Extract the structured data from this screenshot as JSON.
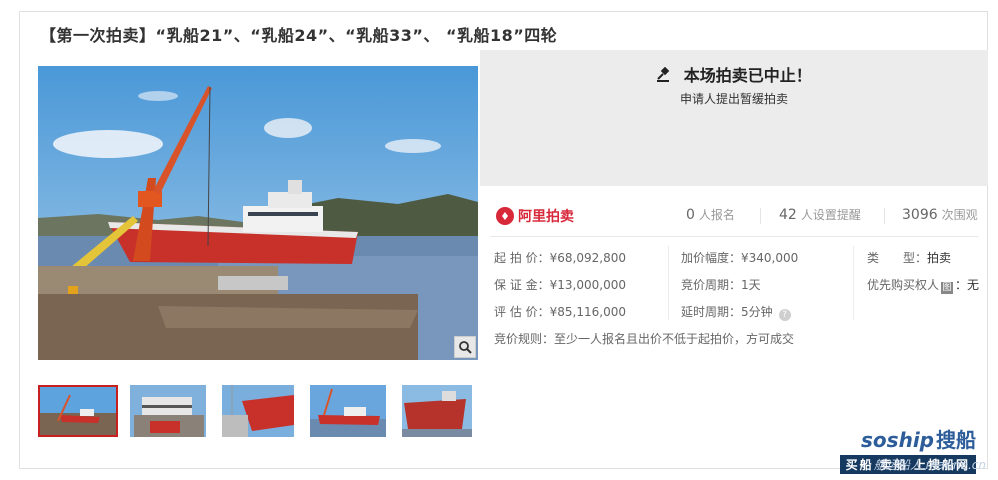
{
  "auction": {
    "title": "【第一次拍卖】“乳船21”、“乳船24”、“乳船33”、 “乳船18”四轮",
    "status": {
      "headline": "本场拍卖已中止！",
      "reason": "申请人提出暂缓拍卖"
    },
    "platform": "阿里拍卖",
    "stats": {
      "signups": {
        "value": "0",
        "label": "人报名"
      },
      "reminders": {
        "value": "42",
        "label": "人设置提醒"
      },
      "views": {
        "value": "3096",
        "label": "次围观"
      }
    },
    "details": {
      "start_price": {
        "label": "起 拍 价：",
        "value": "¥68,092,800"
      },
      "deposit": {
        "label": "保 证 金：",
        "value": "¥13,000,000"
      },
      "appraisal": {
        "label": "评 估 价：",
        "value": "¥85,116,000"
      },
      "increment": {
        "label": "加价幅度：",
        "value": "¥340,000"
      },
      "bid_period": {
        "label": "竞价周期：",
        "value": "1天"
      },
      "extension": {
        "label": "延时周期：",
        "value": "5分钟"
      },
      "type": {
        "label": "类　　型：",
        "value": "拍卖"
      },
      "priority": {
        "label": "优先购买权人",
        "icon_text": "图",
        "value": "：无"
      }
    },
    "rule": {
      "label": "竞价规则：",
      "text": "至少一人报名且出价不低于起拍价，方可成交"
    }
  },
  "watermark": {
    "logo_latin": "soship",
    "logo_cn": "搜船",
    "bar": "买船  卖船  上搜船网",
    "url": "航运船人  marine.cn"
  },
  "colors": {
    "brand_red": "#d8293a",
    "status_bg": "#ececec",
    "active_thumb_border": "#c8201e",
    "watermark_blue": "#2c5d9a"
  }
}
